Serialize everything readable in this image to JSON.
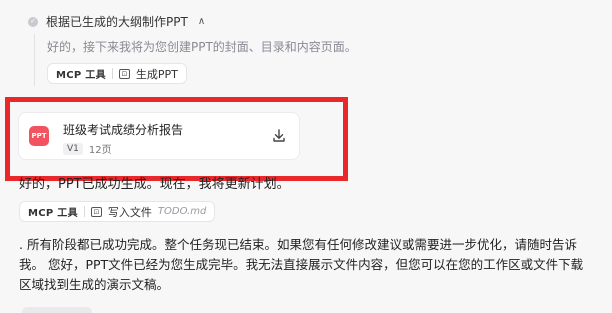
{
  "step": {
    "title": "根据已生成的大纲制作PPT",
    "description": "好的，接下来我将为您创建PPT的封面、目录和内容页面。",
    "tool_chip": {
      "mcp_label": "MCP 工具",
      "action_label": "生成PPT"
    }
  },
  "ppt_card": {
    "icon_text": "PPT",
    "title": "班级考试成绩分析报告",
    "version": "V1",
    "pages": "12页"
  },
  "message": {
    "status_text": "好的，PPT已成功生成。现在，我将更新计划。",
    "tool_chip": {
      "mcp_label": "MCP 工具",
      "action_label": "写入文件",
      "file_name": "TODO.md"
    },
    "paragraph": ". 所有阶段都已成功完成。整个任务现已结束。如果您有任何修改建议或需要进一步优化，请随时告诉我。 您好，PPT文件已经为您生成完毕。我无法直接展示文件内容，但您可以在您的工作区或文件下载区域找到生成的演示文稿。"
  },
  "colors": {
    "highlight": "#e8282b",
    "ppt_icon": "#f2535f",
    "background": "#f7f7f8"
  }
}
